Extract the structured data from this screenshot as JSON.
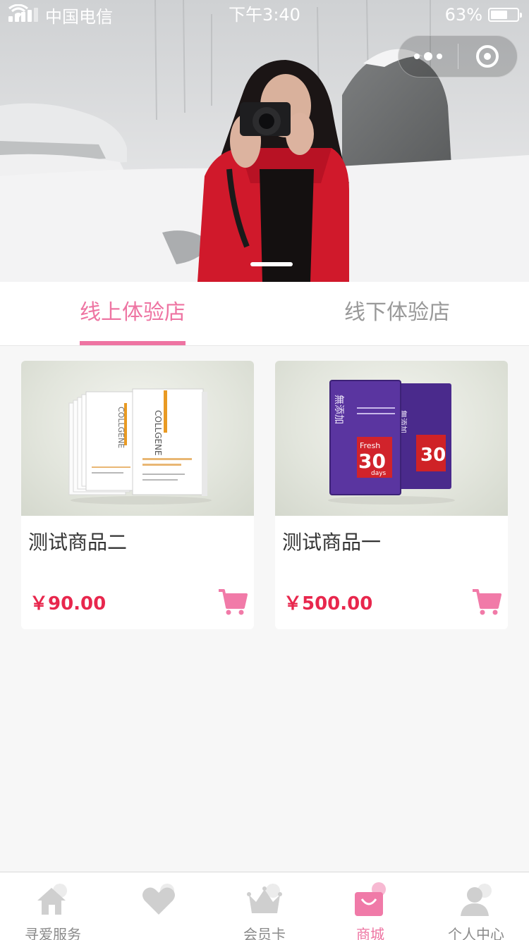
{
  "status_bar": {
    "carrier": "中国电信",
    "time": "下午3:40",
    "battery_percent": "63%",
    "battery_level": 0.63
  },
  "banner": {
    "slide_count": 1,
    "active_slide": 0
  },
  "tabs": [
    {
      "label": "线上体验店",
      "active": true
    },
    {
      "label": "线下体验店",
      "active": false
    }
  ],
  "products": [
    {
      "name": "测试商品二",
      "price": "￥90.00",
      "image_icon": "collagen-mask-box"
    },
    {
      "name": "测试商品一",
      "price": "￥500.00",
      "image_icon": "purple-mask-box"
    }
  ],
  "tab_bar": {
    "active_color": "#ee74a2",
    "items": [
      {
        "label": "寻爱服务",
        "icon": "home-icon",
        "active": false
      },
      {
        "label": "",
        "icon": "heart-icon",
        "active": false
      },
      {
        "label": "会员卡",
        "icon": "crown-icon",
        "active": false
      },
      {
        "label": "商城",
        "icon": "shopping-bag-icon",
        "active": true
      },
      {
        "label": "个人中心",
        "icon": "user-icon",
        "active": false
      }
    ]
  },
  "colors": {
    "accent": "#ee74a2",
    "price": "#e8274d"
  }
}
